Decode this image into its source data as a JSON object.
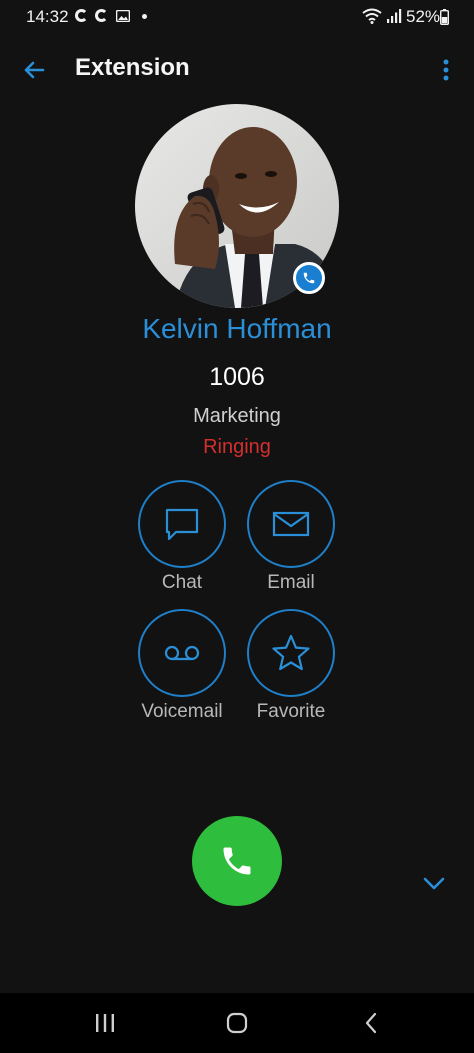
{
  "status_bar": {
    "time": "14:32",
    "battery": "52%"
  },
  "app_bar": {
    "title": "Extension",
    "back_icon": "arrow-left-icon",
    "menu_icon": "more-vert-icon"
  },
  "contact": {
    "name": "Kelvin Hoffman",
    "extension": "1006",
    "department": "Marketing",
    "status": "Ringing",
    "status_color": "#d32f2f",
    "badge_icon": "phone-icon"
  },
  "actions": [
    {
      "label": "Chat",
      "icon": "chat-bubble-icon"
    },
    {
      "label": "Email",
      "icon": "envelope-icon"
    },
    {
      "label": "Voicemail",
      "icon": "voicemail-icon"
    },
    {
      "label": "Favorite",
      "icon": "star-outline-icon"
    }
  ],
  "colors": {
    "accent": "#2b8fd8",
    "call_green": "#2ebd3c",
    "background": "#121212"
  },
  "nav_bar": {
    "recents_icon": "recent-apps-icon",
    "home_icon": "home-icon",
    "back_icon": "back-chevron-icon"
  }
}
